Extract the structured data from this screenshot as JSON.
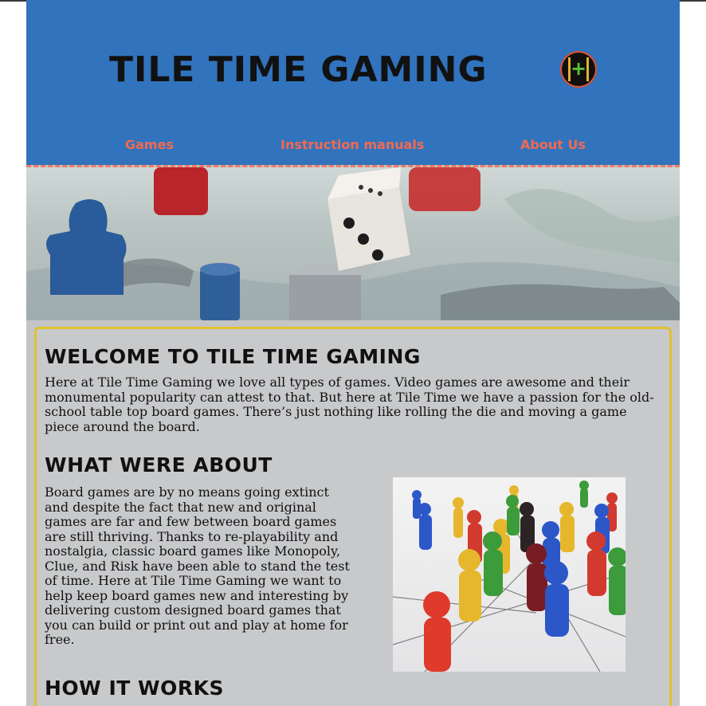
{
  "header": {
    "title": "Tile Time Gaming",
    "logo_icon": "dice-plus-logo-icon",
    "background": "#3173bd"
  },
  "nav": [
    {
      "label": "Games"
    },
    {
      "label": "Instruction manuals"
    },
    {
      "label": "About Us"
    }
  ],
  "hero": {
    "icon": "board-game-pieces-photo"
  },
  "content": {
    "welcome_heading": "Welcome to Tile Time Gaming",
    "welcome_text": "Here at Tile Time Gaming we love all types of games. Video games are awesome and their monumental popularity can attest to that. But here at Tile Time we have a passion for the old-school table top board games. There’s just nothing like rolling the die and moving a game piece around the board.",
    "about_heading": "What were about",
    "about_text": "Board games are by no means going extinct and despite the fact that new and original games are far and few between board games are still thriving. Thanks to re-playability and nostalgia, classic board games like Monopoly, Clue, and Risk have been able to stand the test of time. Here at Tile Time Gaming we want to help keep board games new and interesting by delivering custom designed board games that you can build or print out and play at home for free.",
    "how_heading": "How it works",
    "pawns_photo_icon": "colored-pawns-photo"
  },
  "colors": {
    "nav_text": "#f26a4f",
    "card_border": "#e0c22f",
    "page_background": "#c4c5c7"
  }
}
